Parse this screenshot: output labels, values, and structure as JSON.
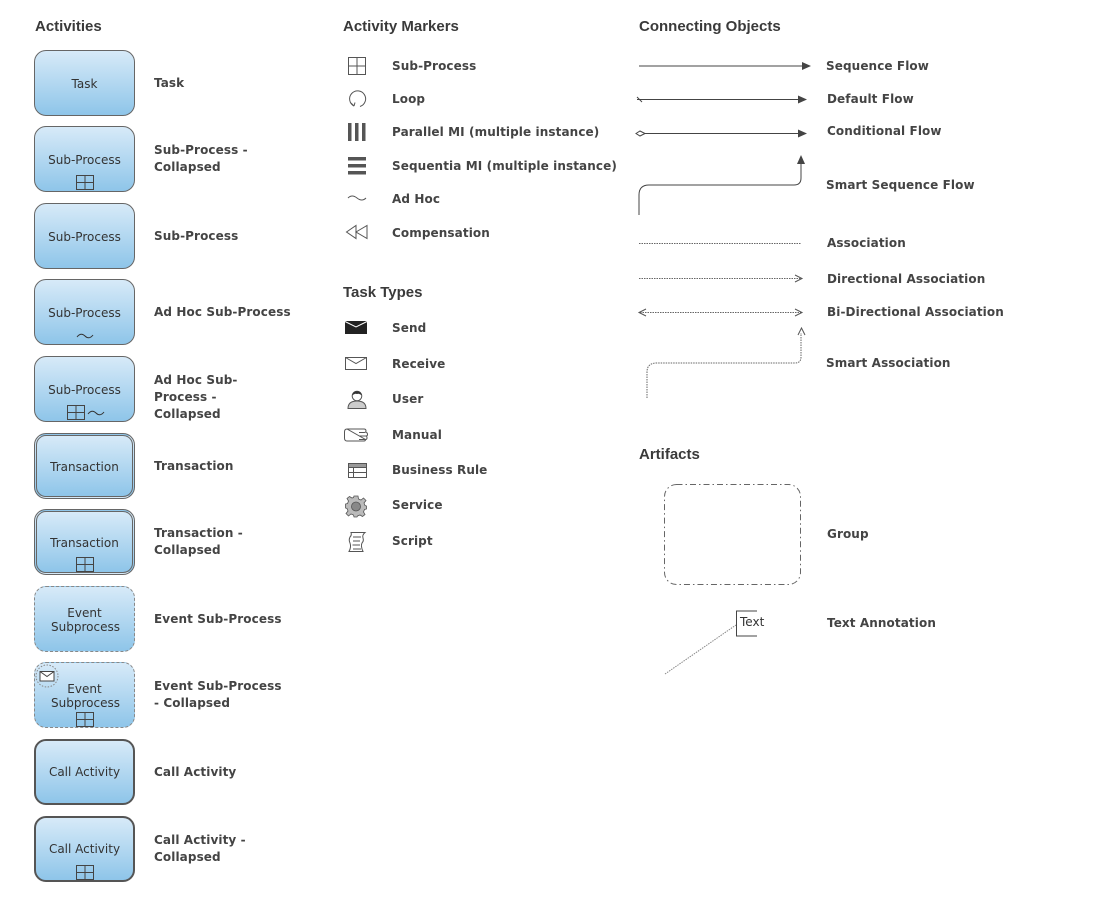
{
  "activities": {
    "heading": "Activities",
    "items": [
      {
        "box": "Task",
        "label": "Task"
      },
      {
        "box": "Sub-Process",
        "label": "Sub-Process - Collapsed"
      },
      {
        "box": "Sub-Process",
        "label": "Sub-Process"
      },
      {
        "box": "Sub-Process",
        "label": "Ad Hoc Sub-Process"
      },
      {
        "box": "Sub-Process",
        "label": "Ad Hoc Sub-Process - Collapsed"
      },
      {
        "box": "Transaction",
        "label": "Transaction"
      },
      {
        "box": "Transaction",
        "label": "Transaction - Collapsed"
      },
      {
        "box": "Event Subprocess",
        "label": "Event Sub-Process"
      },
      {
        "box": "Event Subprocess",
        "label": "Event Sub-Process - Collapsed"
      },
      {
        "box": "Call Activity",
        "label": "Call Activity"
      },
      {
        "box": "Call Activity",
        "label": "Call Activity - Collapsed"
      }
    ]
  },
  "activity_markers": {
    "heading": "Activity Markers",
    "items": [
      {
        "icon": "sub-process-marker",
        "label": "Sub-Process"
      },
      {
        "icon": "loop-marker",
        "label": "Loop"
      },
      {
        "icon": "parallel-mi-marker",
        "label": "Parallel MI (multiple instance)"
      },
      {
        "icon": "sequential-mi-marker",
        "label": "Sequentia MI (multiple instance)"
      },
      {
        "icon": "ad-hoc-marker",
        "label": "Ad Hoc"
      },
      {
        "icon": "compensation-marker",
        "label": "Compensation"
      }
    ]
  },
  "task_types": {
    "heading": "Task Types",
    "items": [
      {
        "icon": "send-envelope",
        "label": "Send"
      },
      {
        "icon": "receive-envelope",
        "label": "Receive"
      },
      {
        "icon": "user",
        "label": "User"
      },
      {
        "icon": "manual-hand",
        "label": "Manual"
      },
      {
        "icon": "business-rule-table",
        "label": "Business Rule"
      },
      {
        "icon": "service-gear",
        "label": "Service"
      },
      {
        "icon": "script-scroll",
        "label": "Script"
      }
    ]
  },
  "connecting_objects": {
    "heading": "Connecting Objects",
    "items": [
      {
        "label": "Sequence Flow"
      },
      {
        "label": "Default Flow"
      },
      {
        "label": "Conditional Flow"
      },
      {
        "label": "Smart Sequence Flow"
      },
      {
        "label": "Association"
      },
      {
        "label": "Directional Association"
      },
      {
        "label": "Bi-Directional Association"
      },
      {
        "label": "Smart Association"
      }
    ]
  },
  "artifacts": {
    "heading": "Artifacts",
    "items": [
      {
        "label": "Group"
      },
      {
        "label": "Text Annotation",
        "annotation_text": "Text"
      }
    ]
  },
  "colors": {
    "box_top": "#d7eaf8",
    "box_bottom": "#8ec5e9",
    "stroke": "#555555"
  }
}
